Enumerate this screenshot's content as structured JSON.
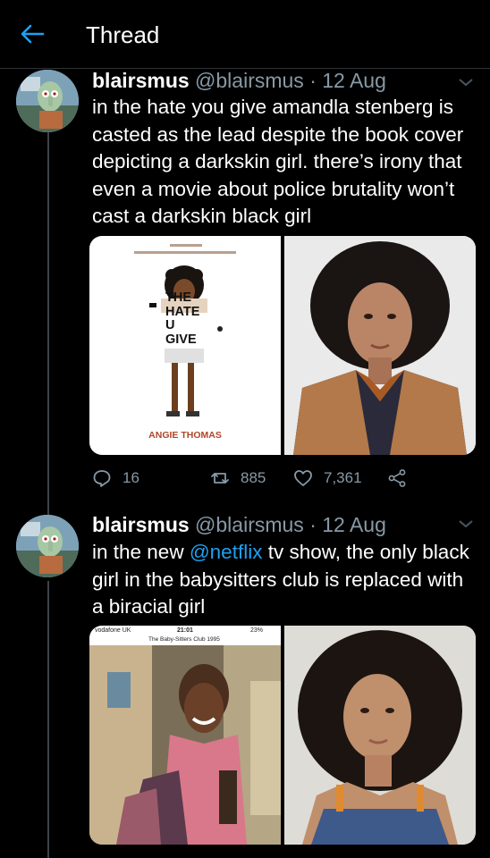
{
  "header": {
    "title": "Thread"
  },
  "tweets": [
    {
      "name": "blairsmus",
      "handle": "@blairsmus",
      "sep": "·",
      "date": "12 Aug",
      "text": "in the hate you give amandla stenberg is casted as the lead despite the book cover depicting a darkskin girl. there’s irony that even a movie about police brutality won’t cast a darkskin black girl",
      "book": {
        "title_line1": "THE",
        "title_line2": "HATE",
        "title_line3": "U",
        "title_line4": "GIVE",
        "author": "ANGIE THOMAS"
      },
      "stats": {
        "replies": "16",
        "retweets": "885",
        "likes": "7,361"
      }
    },
    {
      "name": "blairsmus",
      "handle": "@blairsmus",
      "sep": "·",
      "date": "12 Aug",
      "text_before": "in the new ",
      "mention": "@netflix",
      "text_after": " tv show, the only black girl in the babysitters club is replaced with a biracial girl",
      "phone_status": {
        "carrier": "vodafone UK",
        "time": "21:01",
        "battery": "23%"
      },
      "phone_title": "The Baby-Sitters Club 1995"
    }
  ],
  "colors": {
    "accent": "#1da1f2",
    "muted": "#8899a6",
    "background": "#000000"
  },
  "icons": [
    "back-arrow-icon",
    "chevron-down-icon",
    "reply-icon",
    "retweet-icon",
    "like-icon",
    "share-icon"
  ]
}
